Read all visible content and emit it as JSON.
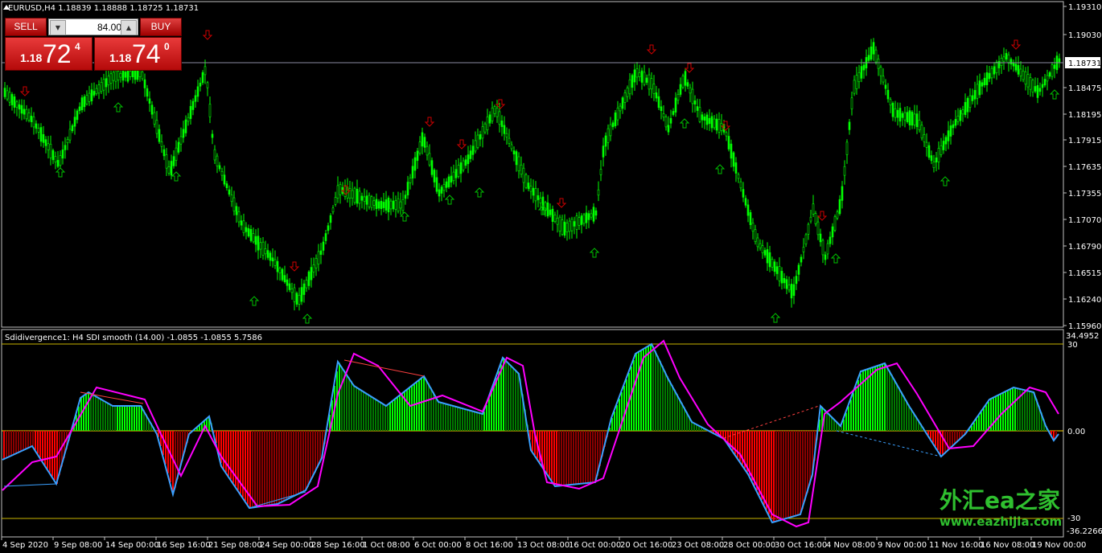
{
  "main_chart": {
    "info": "EURUSD,H4  1.18839 1.18888 1.18725 1.18731",
    "price_ticks": [
      "1.19310",
      "1.19030",
      "1.18731",
      "1.18475",
      "1.18195",
      "1.17915",
      "1.17635",
      "1.17355",
      "1.17070",
      "1.16790",
      "1.16515",
      "1.16240",
      "1.15960"
    ],
    "current_price_label": "1.18731",
    "candle_color": "#00ff00",
    "up_arrow_color": "#00c000",
    "down_arrow_color": "#cc0000"
  },
  "trade_panel": {
    "sell_label": "SELL",
    "buy_label": "BUY",
    "lot_value": "84.00",
    "sell_prefix": "1.18",
    "sell_big": "72",
    "sell_sup": "4",
    "buy_prefix": "1.18",
    "buy_big": "74",
    "buy_sup": "0"
  },
  "indicator": {
    "info": "Sdidivergence1: H4   SDI smooth (14.00) -1.0855 -1.0855 5.7586",
    "scale_top": "34.4952",
    "level_high": "30",
    "level_zero": "0.00",
    "level_low": "-30",
    "scale_bottom": "-36.2266",
    "hist_positive_colors": [
      "#00ff00",
      "#007a00"
    ],
    "hist_negative_colors": [
      "#ff0000",
      "#8b0000"
    ],
    "fast_line_color": "#3aa0ff",
    "slow_line_color": "#ff00ff"
  },
  "time_axis": {
    "labels": [
      "4 Sep 2020",
      "9 Sep 08:00",
      "14 Sep 00:00",
      "16 Sep 16:00",
      "21 Sep 08:00",
      "24 Sep 00:00",
      "28 Sep 16:00",
      "1 Oct 08:00",
      "6 Oct 00:00",
      "8 Oct 16:00",
      "13 Oct 08:00",
      "16 Oct 00:00",
      "20 Oct 16:00",
      "23 Oct 08:00",
      "28 Oct 00:00",
      "30 Oct 16:00",
      "4 Nov 08:00",
      "9 Nov 00:00",
      "11 Nov 16:00",
      "16 Nov 08:00",
      "19 Nov 00:00"
    ]
  },
  "watermark": {
    "title": "外汇ea之家",
    "url": "www.eazhijia.com"
  }
}
